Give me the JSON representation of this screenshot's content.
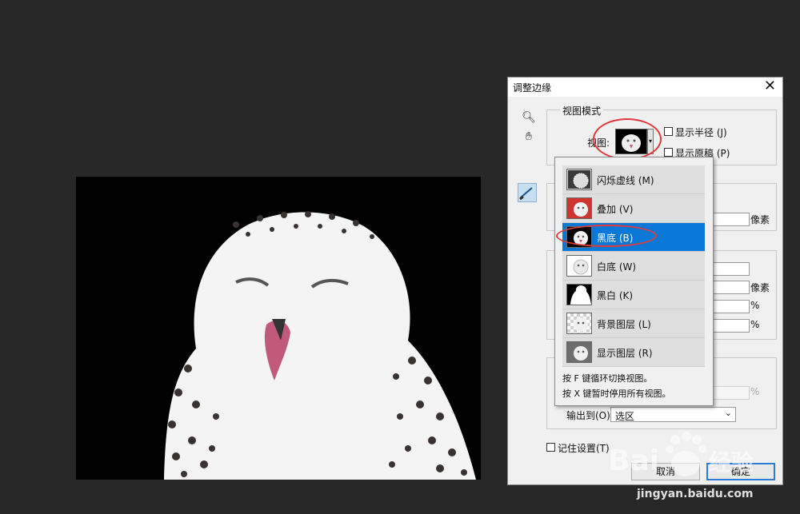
{
  "dialog": {
    "title": "调整边缘",
    "close_icon": "close-icon",
    "tools": [
      "zoom-icon",
      "hand-icon",
      "refine-radius-brush-icon"
    ],
    "view_mode": {
      "legend": "视图模式",
      "view_label": "视图:",
      "show_radius": "显示半径 (J)",
      "show_original": "显示原稿 (P)",
      "current_view": "黑底 (B)"
    },
    "edge_detection": {
      "unit": "像素"
    },
    "adjust_edge": {
      "units": [
        "像素",
        "%",
        "%"
      ]
    },
    "output": {
      "disabled_unit": "%",
      "output_to_label": "输出到(O):",
      "output_to_value": "选区"
    },
    "remember": "记住设置(T)",
    "cancel": "取消",
    "ok": "确定"
  },
  "view_popup": {
    "options": [
      {
        "label": "闪烁虚线 (M)",
        "thumb": "marching-ants"
      },
      {
        "label": "叠加 (V)",
        "thumb": "overlay"
      },
      {
        "label": "黑底 (B)",
        "thumb": "on-black",
        "selected": true
      },
      {
        "label": "白底 (W)",
        "thumb": "on-white"
      },
      {
        "label": "黑白 (K)",
        "thumb": "black-white"
      },
      {
        "label": "背景图层 (L)",
        "thumb": "on-layers"
      },
      {
        "label": "显示图层 (R)",
        "thumb": "reveal-layer"
      }
    ],
    "hint1": "按 F 键循环切换视图。",
    "hint2": "按 X 键暂时停用所有视图。"
  },
  "watermark": {
    "brand": "Bai 经验",
    "url": "jingyan.baidu.com"
  },
  "colors": {
    "accent": "#0a78d7",
    "annotation": "#e23a3a",
    "background": "#282828"
  }
}
